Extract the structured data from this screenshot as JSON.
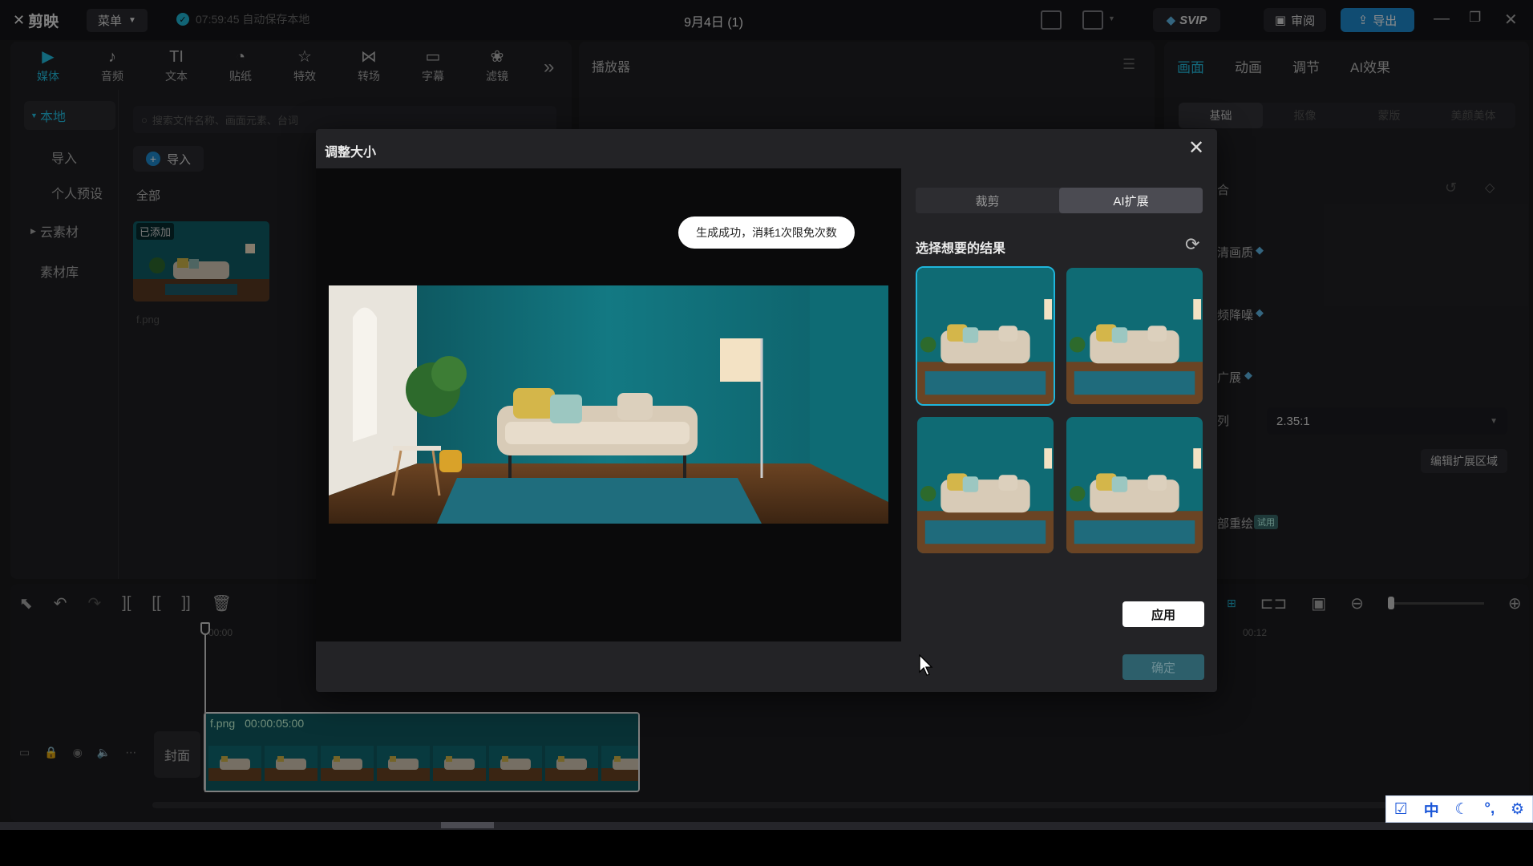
{
  "app": {
    "logo_text": "剪映",
    "menu_label": "菜单",
    "autosave_text": "07:59:45 自动保存本地",
    "project_title": "9月4日 (1)",
    "svip_label": "SVIP",
    "review_label": "审阅",
    "export_label": "导出"
  },
  "tool_tabs": [
    {
      "label": "媒体",
      "icon": "media-icon",
      "glyph": "▶",
      "active": true
    },
    {
      "label": "音频",
      "icon": "audio-icon",
      "glyph": "♪",
      "active": false
    },
    {
      "label": "文本",
      "icon": "text-icon",
      "glyph": "TI",
      "active": false
    },
    {
      "label": "贴纸",
      "icon": "sticker-icon",
      "glyph": "◔",
      "active": false
    },
    {
      "label": "特效",
      "icon": "effects-icon",
      "glyph": "☆",
      "active": false
    },
    {
      "label": "转场",
      "icon": "transition-icon",
      "glyph": "⋈",
      "active": false
    },
    {
      "label": "字幕",
      "icon": "subtitle-icon",
      "glyph": "▭",
      "active": false
    },
    {
      "label": "滤镜",
      "icon": "filter-icon",
      "glyph": "❀",
      "active": false
    }
  ],
  "side_nav": {
    "local": "本地",
    "import": "导入",
    "personal_preset": "个人预设",
    "cloud_material": "云素材",
    "library": "素材库"
  },
  "media": {
    "search_placeholder": "搜索文件名称、画面元素、台词",
    "import_label": "导入",
    "section_all": "全部",
    "added_tag": "已添加",
    "file_name": "f.png"
  },
  "player": {
    "title": "播放器"
  },
  "right_panel": {
    "tabs": [
      "画面",
      "动画",
      "调节",
      "AI效果"
    ],
    "subtabs": [
      "基础",
      "抠像",
      "蒙版",
      "美颜美体"
    ],
    "row_blend": "合",
    "row_quality": "清画质",
    "row_denoise": "频降噪",
    "row_expand": "广展",
    "row_ratio_label": "列",
    "ratio_value": "2.35:1",
    "edit_expand_label": "编辑扩展区域",
    "row_repaint": "部重绘",
    "trial_badge": "试用"
  },
  "timeline": {
    "ruler_start": "00:00",
    "ruler_end": "00:12",
    "cover_label": "封面",
    "clip_name": "f.png",
    "clip_duration": "00:00:05:00"
  },
  "modal": {
    "title": "调整大小",
    "toast": "生成成功，消耗1次限免次数",
    "tab_crop": "裁剪",
    "tab_ai_expand": "AI扩展",
    "choose_title": "选择想要的结果",
    "apply_label": "应用",
    "confirm_label": "确定"
  },
  "ime": {
    "lang": "中"
  },
  "colors": {
    "accent": "#23bfe2",
    "export_blue": "#1e8bd0",
    "wall_teal": "#0f6b74"
  }
}
